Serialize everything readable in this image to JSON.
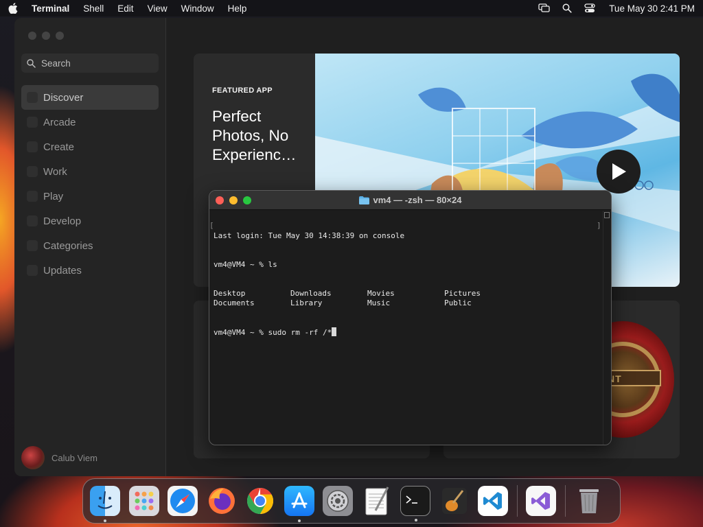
{
  "menubar": {
    "app_name": "Terminal",
    "menus": [
      "Shell",
      "Edit",
      "View",
      "Window",
      "Help"
    ],
    "clock": "Tue May 30  2:41 PM"
  },
  "appstore": {
    "search_placeholder": "Search",
    "nav": [
      "Discover",
      "Arcade",
      "Create",
      "Work",
      "Play",
      "Develop",
      "Categories",
      "Updates"
    ],
    "active_nav": "Discover",
    "user_name": "Calub Viem",
    "featured": {
      "eyebrow": "FEATURED APP",
      "title": "Perfect Photos, No Experienc…"
    },
    "medal_text": "MENT"
  },
  "terminal": {
    "title": "vm4 — -zsh — 80×24",
    "last_login": "Last login: Tue May 30 14:38:39 on console",
    "prompt1": "vm4@VM4 ~ % ls",
    "ls_row1": [
      "Desktop",
      "Downloads",
      "Movies",
      "Pictures"
    ],
    "ls_row2": [
      "Documents",
      "Library",
      "Music",
      "Public"
    ],
    "prompt2": "vm4@VM4 ~ % sudo rm -rf /*"
  },
  "dock": {
    "apps": [
      "Finder",
      "Launchpad",
      "Safari",
      "Firefox",
      "Chrome",
      "App Store",
      "System Settings",
      "TextEdit",
      "Terminal",
      "GarageBand",
      "Visual Studio Code",
      "Visual Studio",
      "Trash"
    ]
  },
  "colors": {
    "close": "#fe5f57",
    "minimize": "#febc2e",
    "maximize": "#28c840",
    "accent": "#0a84ff"
  }
}
